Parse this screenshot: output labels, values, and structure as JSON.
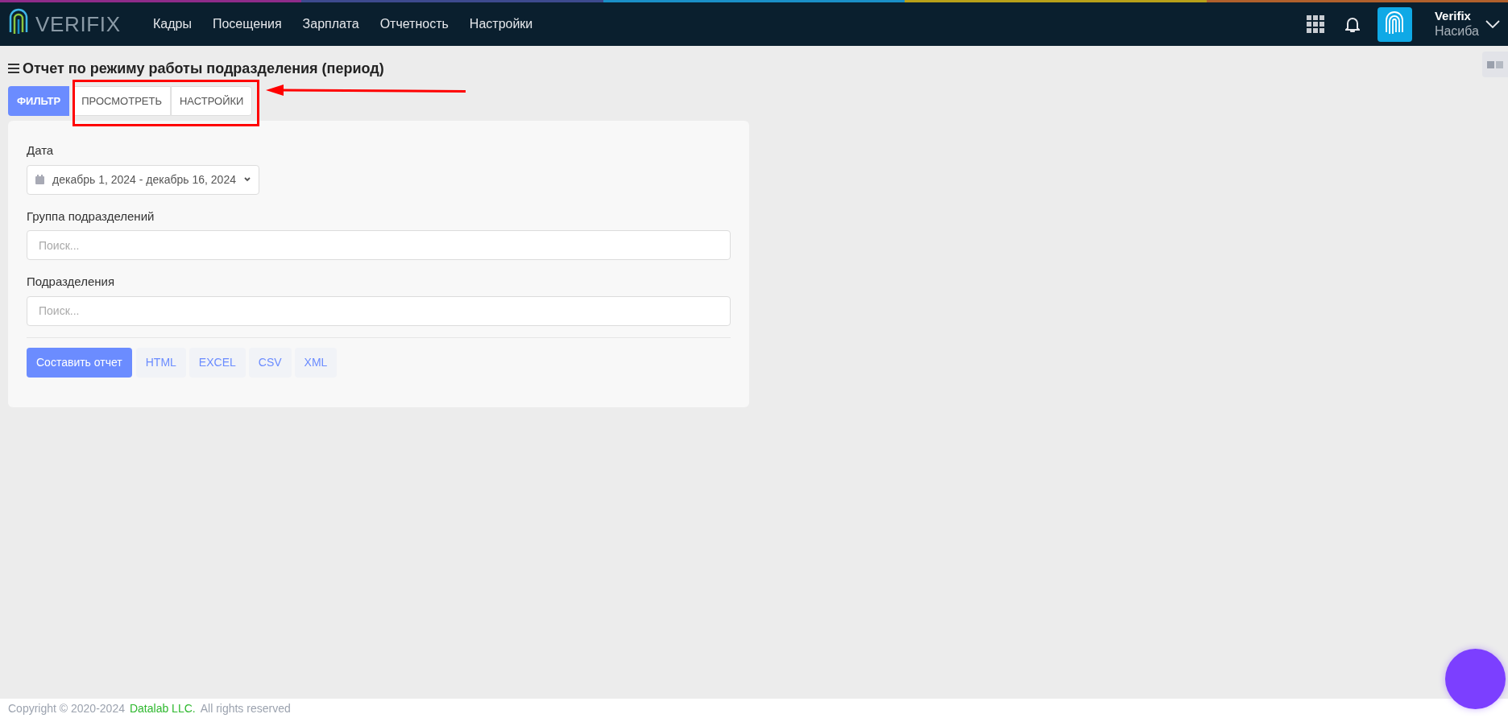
{
  "header": {
    "logo_text": "VERIFIX",
    "nav": [
      {
        "label": "Кадры"
      },
      {
        "label": "Посещения"
      },
      {
        "label": "Зарплата"
      },
      {
        "label": "Отчетность"
      },
      {
        "label": "Настройки"
      }
    ],
    "user": {
      "name": "Verifix",
      "subtitle": "Насиба"
    }
  },
  "page": {
    "title": "Отчет по режиму работы подразделения (период)"
  },
  "tabs": [
    {
      "label": "ФИЛЬТР",
      "selected": true
    },
    {
      "label": "ПРОСМОТРЕТЬ",
      "selected": false
    },
    {
      "label": "НАСТРОЙКИ",
      "selected": false
    }
  ],
  "form": {
    "fields": [
      {
        "kind": "daterange",
        "label": "Дата",
        "value": "декабрь 1, 2024 - декабрь 16, 2024"
      },
      {
        "kind": "search",
        "label": "Группа подразделений",
        "placeholder": "Поиск..."
      },
      {
        "kind": "search",
        "label": "Подразделения",
        "placeholder": "Поиск..."
      }
    ],
    "buttons": [
      {
        "label": "Составить отчет",
        "kind": "primary"
      },
      {
        "label": "HTML",
        "kind": "format"
      },
      {
        "label": "EXCEL",
        "kind": "format"
      },
      {
        "label": "CSV",
        "kind": "format"
      },
      {
        "label": "XML",
        "kind": "format"
      }
    ]
  },
  "footer": {
    "prefix": "Copyright © 2020-2024",
    "company": "Datalab LLC.",
    "suffix": "All rights reserved"
  }
}
